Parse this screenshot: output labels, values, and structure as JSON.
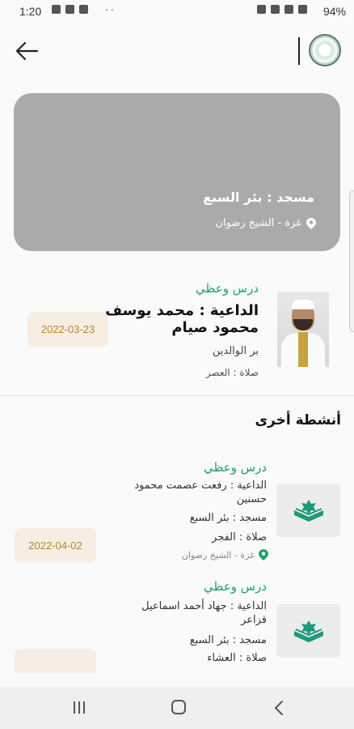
{
  "status_bar": {
    "time": "1:20",
    "dots": "··",
    "battery": "94%"
  },
  "app_bar": {
    "back_icon": "arrow-left-icon",
    "logo_icon": "organization-logo-icon"
  },
  "hero": {
    "mosque": "مسجد : بئر السبع",
    "location": "غزة - الشيخ رضوان",
    "location_icon": "location-pin-icon"
  },
  "main_activity": {
    "type": "درس وعظي",
    "preacher": "الداعية :  محمد يوسف محمود صيام",
    "topic": "بر الوالدين",
    "prayer": "صلاة : العصر",
    "date": "2022-03-23"
  },
  "other_activities": {
    "title": "أنشطة أخرى",
    "items": [
      {
        "type": "درس وعظي",
        "preacher": "الداعية :  رفعت عصمت محمود حسنين",
        "mosque": "مسجد : بئر السبع",
        "prayer": "صلاة : الفجر",
        "location": "غزة - الشيخ رضوان",
        "date": "2022-04-02",
        "icon": "quran-book-icon"
      },
      {
        "type": "درس وعظي",
        "preacher": "الداعية :  جهاد أحمد اسماعيل قزاعر",
        "mosque": "مسجد : بئر السبع",
        "prayer": "صلاة : العشاء",
        "icon": "quran-book-icon"
      }
    ]
  },
  "colors": {
    "accent_green": "#22a06b",
    "date_text": "#b8862f",
    "date_bg": "#f7ede3",
    "hero_bg": "#aaaaaa"
  }
}
